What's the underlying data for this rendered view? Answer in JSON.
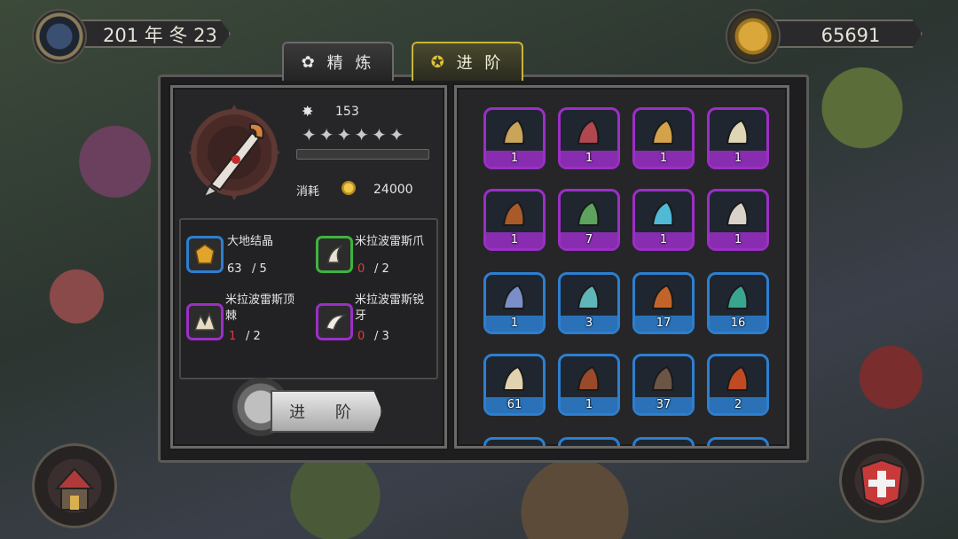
{
  "hud": {
    "date_text": "201 年 冬 23",
    "gold_text": "65691"
  },
  "tabs": [
    {
      "label": "精 炼",
      "icon": "ornament-icon",
      "active": false
    },
    {
      "label": "进 阶",
      "icon": "rank-badge-icon",
      "active": true
    }
  ],
  "item": {
    "power": "153",
    "stars": "✦✦✦✦✦✦",
    "cost_label": "消耗",
    "cost_value": "24000"
  },
  "materials": [
    {
      "name": "大地结晶",
      "have": "63",
      "need": "/ 5",
      "enough": true,
      "rarity_color": "#2d7fd0",
      "icon": "crystal-icon"
    },
    {
      "name": "米拉波雷斯爪",
      "have": "0",
      "need": "/ 2",
      "enough": false,
      "rarity_color": "#3fb33f",
      "icon": "claw-icon"
    },
    {
      "name": "米拉波雷斯顶棘",
      "have": "1",
      "need": "/ 2",
      "enough": false,
      "rarity_color": "#9b2fc6",
      "icon": "spike-icon"
    },
    {
      "name": "米拉波雷斯锐牙",
      "have": "0",
      "need": "/ 3",
      "enough": false,
      "rarity_color": "#9b2fc6",
      "icon": "fang-icon"
    }
  ],
  "advance_button": "进 阶",
  "inventory": [
    {
      "count": "1",
      "rarity": "purple",
      "icon": "horn-icon",
      "fill": "#c9a55a"
    },
    {
      "count": "1",
      "rarity": "purple",
      "icon": "leaf-gem-icon",
      "fill": "#b0484f"
    },
    {
      "count": "1",
      "rarity": "purple",
      "icon": "egg-icon",
      "fill": "#d4a24a"
    },
    {
      "count": "1",
      "rarity": "purple",
      "icon": "spike-icon",
      "fill": "#e0d6b5"
    },
    {
      "count": "1",
      "rarity": "purple",
      "icon": "claw-icon",
      "fill": "#a85a28"
    },
    {
      "count": "7",
      "rarity": "purple",
      "icon": "clover-icon",
      "fill": "#5da25d"
    },
    {
      "count": "1",
      "rarity": "purple",
      "icon": "crystal-icon",
      "fill": "#4fb9d6"
    },
    {
      "count": "1",
      "rarity": "purple",
      "icon": "bone-icon",
      "fill": "#d9d2c8"
    },
    {
      "count": "1",
      "rarity": "blue",
      "icon": "mushroom-icon",
      "fill": "#7a8fc8"
    },
    {
      "count": "3",
      "rarity": "blue",
      "icon": "feather-icon",
      "fill": "#5fb5b8"
    },
    {
      "count": "17",
      "rarity": "blue",
      "icon": "ore-icon",
      "fill": "#c2642a"
    },
    {
      "count": "16",
      "rarity": "blue",
      "icon": "drop-icon",
      "fill": "#3aa58f"
    },
    {
      "count": "61",
      "rarity": "blue",
      "icon": "tusk-icon",
      "fill": "#e2d3b0"
    },
    {
      "count": "1",
      "rarity": "blue",
      "icon": "plank-icon",
      "fill": "#9a4a2a"
    },
    {
      "count": "37",
      "rarity": "blue",
      "icon": "scale-icon",
      "fill": "#6b5544"
    },
    {
      "count": "2",
      "rarity": "blue",
      "icon": "flame-leaf-icon",
      "fill": "#c04a22"
    }
  ],
  "colors": {
    "purple": "#9b2fc6",
    "blue": "#2d7fd0",
    "gold": "#d4a231",
    "insufficient": "#e23a3a"
  }
}
